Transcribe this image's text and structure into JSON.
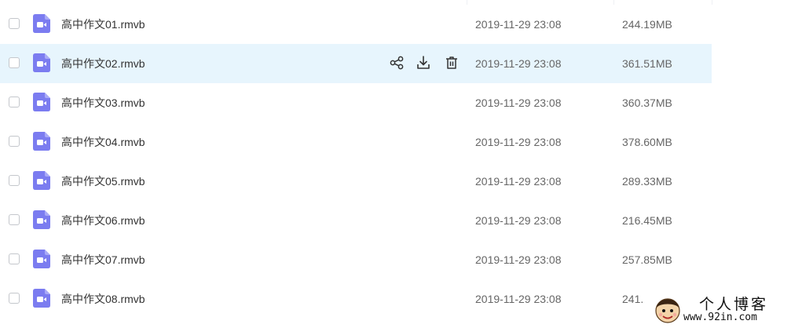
{
  "file_list": {
    "rows": [
      {
        "name": "高中作文01.rmvb",
        "date": "2019-11-29 23:08",
        "size": "244.19MB",
        "hovered": false
      },
      {
        "name": "高中作文02.rmvb",
        "date": "2019-11-29 23:08",
        "size": "361.51MB",
        "hovered": true
      },
      {
        "name": "高中作文03.rmvb",
        "date": "2019-11-29 23:08",
        "size": "360.37MB",
        "hovered": false
      },
      {
        "name": "高中作文04.rmvb",
        "date": "2019-11-29 23:08",
        "size": "378.60MB",
        "hovered": false
      },
      {
        "name": "高中作文05.rmvb",
        "date": "2019-11-29 23:08",
        "size": "289.33MB",
        "hovered": false
      },
      {
        "name": "高中作文06.rmvb",
        "date": "2019-11-29 23:08",
        "size": "216.45MB",
        "hovered": false
      },
      {
        "name": "高中作文07.rmvb",
        "date": "2019-11-29 23:08",
        "size": "257.85MB",
        "hovered": false
      },
      {
        "name": "高中作文08.rmvb",
        "date": "2019-11-29 23:08",
        "size": "241.",
        "hovered": false
      }
    ],
    "row_actions": {
      "icons": [
        "share-icon",
        "download-icon",
        "delete-icon"
      ]
    },
    "file_icon": "video-file-icon"
  },
  "watermark": {
    "title": "个人博客",
    "url": "www.92in.com"
  },
  "colors": {
    "hover_row": "#e7f5fd",
    "file_icon": "#7b7cf0",
    "text_primary": "#333333",
    "text_secondary": "#666666",
    "checkbox_border": "#c4c7cc"
  }
}
